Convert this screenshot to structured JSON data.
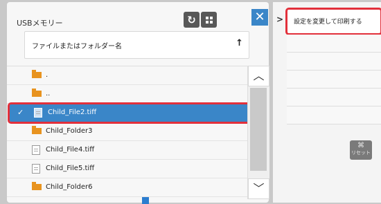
{
  "header": {
    "title": "USBメモリー",
    "refresh_icon": "↻",
    "close_icon": "✕"
  },
  "sort": {
    "label": "ファイルまたはフォルダー名",
    "arrow": "↑"
  },
  "list": {
    "items": [
      {
        "name": ".",
        "type": "folder"
      },
      {
        "name": "..",
        "type": "folder"
      },
      {
        "name": "Child_File2.tiff",
        "type": "file",
        "selected": true,
        "check": "✓"
      },
      {
        "name": "Child_Folder3",
        "type": "folder"
      },
      {
        "name": "Child_File4.tiff",
        "type": "file"
      },
      {
        "name": "Child_File5.tiff",
        "type": "file"
      },
      {
        "name": "Child_Folder6",
        "type": "folder"
      }
    ]
  },
  "scrollbar": {
    "up": "︿",
    "down": "﹀"
  },
  "right": {
    "chevron": ">",
    "print_with_settings": "設定を変更して印刷する",
    "reset_icon": "⌘",
    "reset_label": "リセット"
  },
  "colors": {
    "accent": "#3a86c8",
    "highlight": "#e2303b",
    "folder": "#e8931f"
  }
}
